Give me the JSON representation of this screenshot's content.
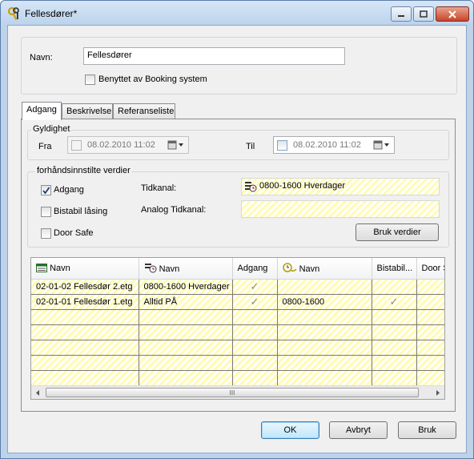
{
  "window": {
    "title": "Fellesdører*",
    "icon": "keys-icon",
    "buttons": [
      "minimize",
      "maximize",
      "close"
    ]
  },
  "header": {
    "name_label": "Navn:",
    "name_value": "Fellesdører",
    "booking_label": "Benyttet av Booking system",
    "booking_checked": false
  },
  "tabs": [
    {
      "label": "Adgang",
      "active": true
    },
    {
      "label": "Beskrivelse",
      "active": false
    },
    {
      "label": "Referanseliste",
      "active": false
    }
  ],
  "validity": {
    "group_title": "Gyldighet",
    "from_label": "Fra",
    "from_value": "08.02.2010  11:02",
    "to_label": "Til",
    "to_value": "08.02.2010  11:02"
  },
  "presets": {
    "group_title": "forhåndsinnstilte verdier",
    "adgang_label": "Adgang",
    "adgang_checked": true,
    "bistabil_label": "Bistabil låsing",
    "bistabil_checked": false,
    "doorsafe_label": "Door Safe",
    "doorsafe_checked": false,
    "tidkanal_label": "Tidkanal:",
    "tidkanal_value": "0800-1600 Hverdager",
    "analog_label": "Analog Tidkanal:",
    "analog_value": "",
    "apply_button": "Bruk verdier"
  },
  "grid": {
    "columns": [
      "Navn",
      "Navn",
      "Adgang",
      "Navn",
      "Bistabil...",
      "Door S"
    ],
    "rows": [
      {
        "door": "02-01-02 Fellesdør 2.etg",
        "timechannel": "0800-1600 Hverdager",
        "adgang": true,
        "analog": "",
        "bistabil": false
      },
      {
        "door": "02-01-01 Fellesdør 1.etg",
        "timechannel": "Alltid PÅ",
        "adgang": true,
        "analog": "0800-1600",
        "bistabil": true
      }
    ],
    "scroll_grip": "III"
  },
  "footer": {
    "ok": "OK",
    "cancel": "Avbryt",
    "apply": "Bruk"
  },
  "colors": {
    "hatch_yellow": "#fffbb5",
    "title_bar": "#c6d9ee",
    "close_red": "#c8442a"
  }
}
